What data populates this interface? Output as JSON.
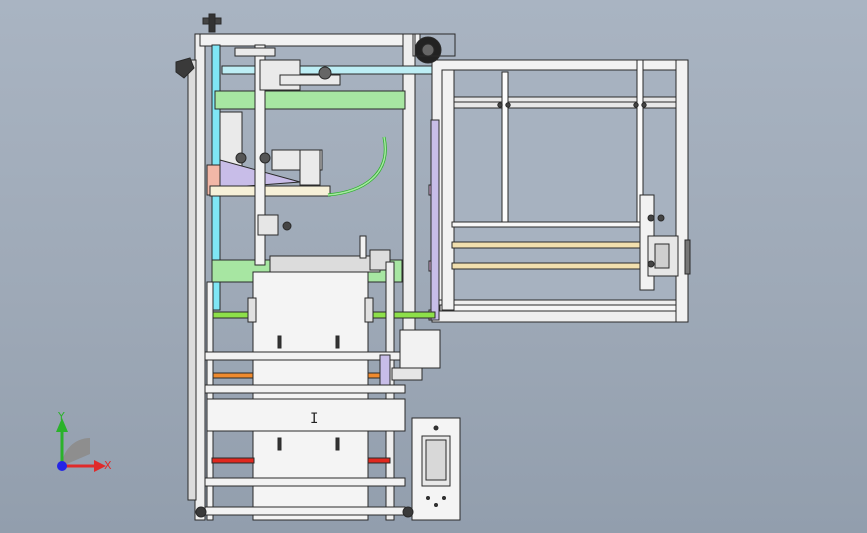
{
  "viewport": {
    "background_top": "#a9b4c2",
    "background_bottom": "#929ead",
    "model": {
      "frame_color": "#f2f2f2",
      "outline_color": "#2a2a2a",
      "bracket_color": "#c8bde8",
      "cyan_rod": "#7fe6f5",
      "green_plate": "#a7e6a2",
      "lime_rod": "#8de04a",
      "orange_rod": "#ef8a2e",
      "red_rod": "#e0281e",
      "tan_rod": "#f1dfae",
      "salmon_block": "#f2b7a7",
      "pink_block": "#e7b6e4",
      "center_part_label": "I"
    },
    "triad": {
      "y_label": "Y",
      "x_label": "X",
      "y_color": "#2bb22b",
      "x_color": "#e02a2a",
      "origin_color": "#2424e6"
    }
  }
}
